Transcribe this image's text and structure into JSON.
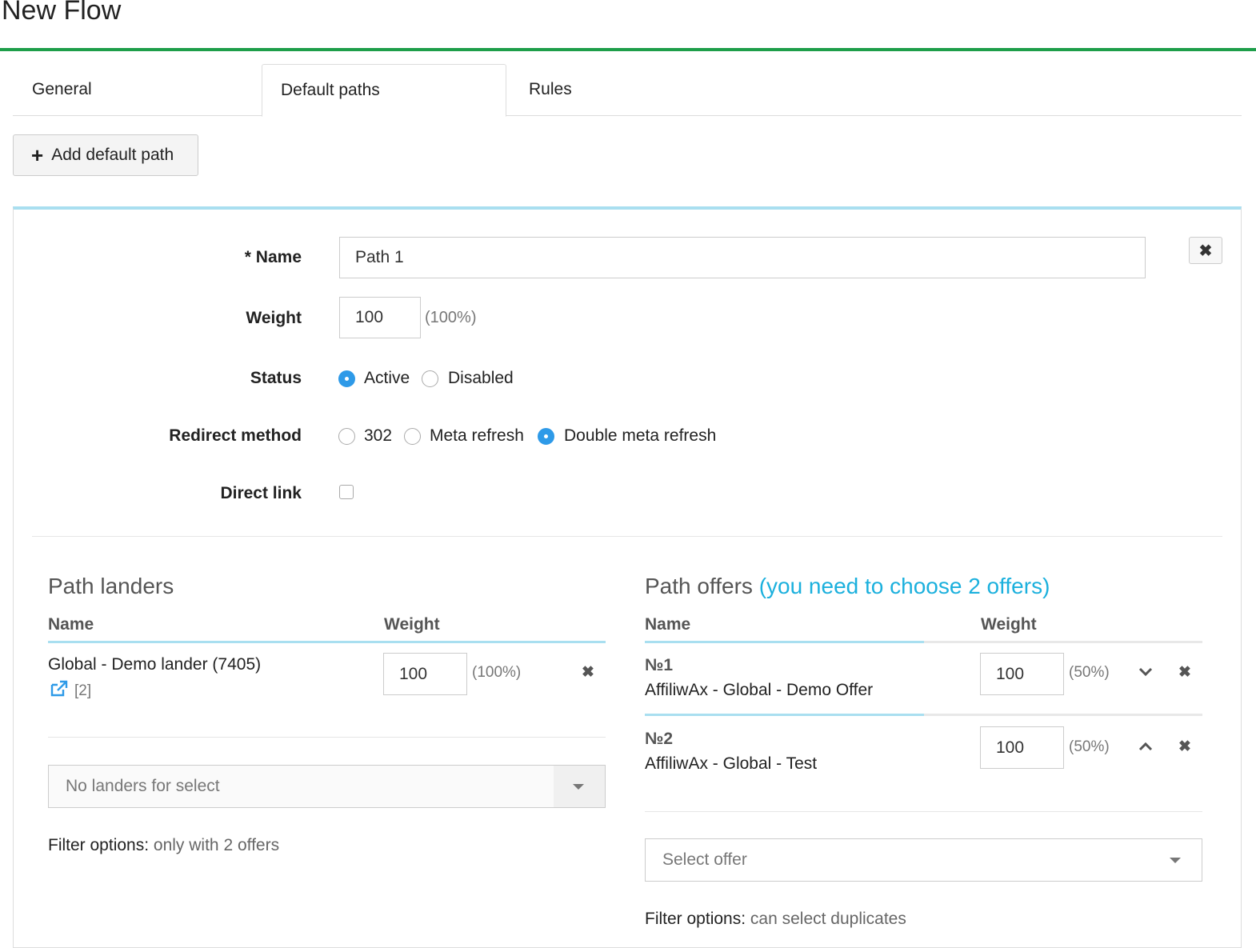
{
  "page": {
    "title": "New Flow"
  },
  "tabs": [
    {
      "label": "General"
    },
    {
      "label": "Default paths"
    },
    {
      "label": "Rules"
    }
  ],
  "add_button": {
    "label": "Add default path"
  },
  "form": {
    "name_label": "* Name",
    "name_value": "Path 1",
    "weight_label": "Weight",
    "weight_value": "100",
    "weight_percent": "(100%)",
    "status_label": "Status",
    "status_options": [
      "Active",
      "Disabled"
    ],
    "status_selected": "Active",
    "redirect_label": "Redirect method",
    "redirect_options": [
      "302",
      "Meta refresh",
      "Double meta refresh"
    ],
    "redirect_selected": "Double meta refresh",
    "direct_link_label": "Direct link",
    "direct_link_checked": false
  },
  "landers": {
    "title": "Path landers",
    "col_name": "Name",
    "col_weight": "Weight",
    "rows": [
      {
        "name": "Global - Demo lander (7405)",
        "count": "[2]",
        "weight": "100",
        "percent": "(100%)"
      }
    ],
    "select_placeholder": "No landers for select",
    "filter_label": "Filter options:",
    "filter_value": "only with 2 offers"
  },
  "offers": {
    "title": "Path offers",
    "hint": "(you need to choose 2 offers)",
    "col_name": "Name",
    "col_weight": "Weight",
    "rows": [
      {
        "num": "№1",
        "name": "AffiliwAx - Global - Demo Offer",
        "weight": "100",
        "percent": "(50%)"
      },
      {
        "num": "№2",
        "name": "AffiliwAx - Global - Test",
        "weight": "100",
        "percent": "(50%)"
      }
    ],
    "select_placeholder": "Select offer",
    "filter_label": "Filter options:",
    "filter_value": "can select duplicates"
  },
  "colors": {
    "accent_green": "#1e9e4a",
    "accent_blue": "#2e9ae8",
    "hint_blue": "#1bb0dd",
    "panel_top": "#a9dff0"
  }
}
